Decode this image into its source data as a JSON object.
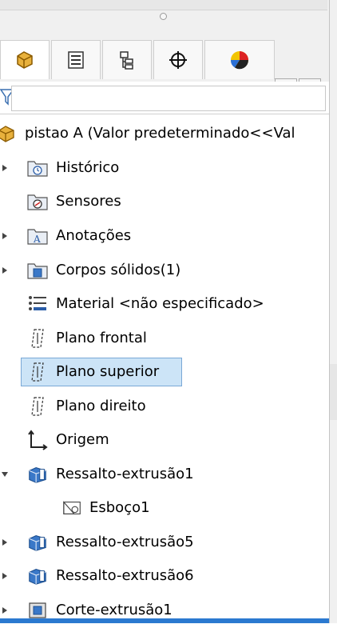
{
  "tabs": [
    {
      "name": "feature-manager-tab",
      "icon": "feature-tree-icon",
      "active": true
    },
    {
      "name": "property-manager-tab",
      "icon": "property-list-icon"
    },
    {
      "name": "configuration-manager-tab",
      "icon": "configuration-icon"
    },
    {
      "name": "dimxpert-tab",
      "icon": "crosshair-icon"
    },
    {
      "name": "display-manager-tab",
      "icon": "display-pie-icon"
    }
  ],
  "scroll": {
    "left": "◂",
    "right": "▸"
  },
  "tree": {
    "root": "pistao A  (Valor predeterminado<<Val",
    "items": [
      {
        "label": "Histórico",
        "icon": "history-folder-icon",
        "expand": true
      },
      {
        "label": "Sensores",
        "icon": "sensor-folder-icon",
        "expand": false
      },
      {
        "label": "Anotações",
        "icon": "annotation-folder-icon",
        "expand": true
      },
      {
        "label": "Corpos sólidos(1)",
        "icon": "solid-bodies-folder-icon",
        "expand": true
      },
      {
        "label": "Material <não especificado>",
        "icon": "material-icon",
        "expand": false
      },
      {
        "label": "Plano frontal",
        "icon": "plane-icon",
        "expand": false
      },
      {
        "label": "Plano superior",
        "icon": "plane-icon",
        "expand": false,
        "selected": true
      },
      {
        "label": "Plano direito",
        "icon": "plane-icon",
        "expand": false
      },
      {
        "label": "Origem",
        "icon": "origin-icon",
        "expand": false
      },
      {
        "label": "Ressalto-extrusão1",
        "icon": "extrude-boss-icon",
        "expand": true,
        "open": true
      },
      {
        "label": "Esboço1",
        "icon": "sketch-icon",
        "expand": false,
        "child": true
      },
      {
        "label": "Ressalto-extrusão5",
        "icon": "extrude-boss-icon",
        "expand": true
      },
      {
        "label": "Ressalto-extrusão6",
        "icon": "extrude-boss-icon",
        "expand": true
      },
      {
        "label": "Corte-extrusão1",
        "icon": "extrude-cut-icon",
        "expand": true
      }
    ]
  },
  "colors": {
    "selection": "#cce4f7",
    "selection_border": "#7aa8d6",
    "accent": "#2b79d0",
    "folder": "#e8c86e"
  }
}
